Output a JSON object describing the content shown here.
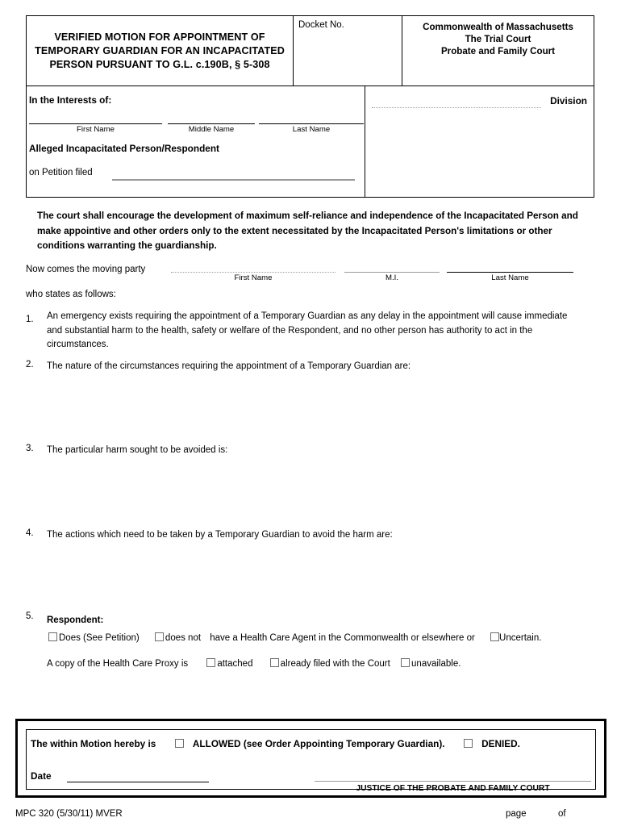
{
  "form": {
    "header": {
      "title": "VERIFIED MOTION FOR APPOINTMENT OF TEMPORARY GUARDIAN FOR AN INCAPACITATED PERSON  PURSUANT TO G.L. c.190B, § 5-308",
      "docket_label": "Docket No.",
      "docket_value": "",
      "court_line_1": "Commonwealth of Massachusetts",
      "court_line_2": "The Trial Court",
      "court_line_3": "Probate and Family Court"
    },
    "interests": {
      "label": "In the Interests of:",
      "first_name_value": "",
      "first_name_caption": "First Name",
      "middle_name_value": "",
      "middle_name_caption": "Middle Name",
      "last_name_value": "",
      "last_name_caption": "Last Name",
      "respondent_label": "Alleged Incapacitated Person/Respondent",
      "petition_label": "on Petition filed",
      "petition_value": "",
      "division_value": "",
      "division_label": "Division"
    },
    "instruction": "The court shall encourage the development of maximum self-reliance and independence of the Incapacitated Person and make appointive and other orders only to the extent necessitated by the Incapacitated Person's limitations or other conditions warranting the guardianship.",
    "moving_party": {
      "label": "Now comes the moving party",
      "first_name_value": "",
      "first_name_caption": "First Name",
      "mi_value": "",
      "mi_caption": "M.I.",
      "last_name_value": "",
      "last_name_caption": "Last Name"
    },
    "who_states": "who states as follows:",
    "items": [
      {
        "num": "1.",
        "text": "An emergency exists requiring the appointment of a Temporary Guardian as any delay in the appointment will cause immediate and substantial harm to the health, safety or welfare of the Respondent, and no other person has authority to act in the circumstances."
      },
      {
        "num": "2.",
        "text": "The nature of the circumstances requiring the appointment of a Temporary Guardian are:"
      },
      {
        "num": "3.",
        "text": "The particular harm sought to be avoided is:"
      },
      {
        "num": "4.",
        "text": "The actions which need to be taken by a Temporary Guardian to avoid the harm are:"
      }
    ],
    "respondent_item": {
      "num": "5.",
      "title": "Respondent:",
      "option_does": "Does (See Petition)",
      "option_does_not": "does not",
      "agent_text": "have a Health Care Agent in the Commonwealth or elsewhere or",
      "option_uncertain": "Uncertain.",
      "proxy_label": "A copy of the Health Care Proxy is",
      "option_attached": "attached",
      "option_already_filed": "already filed with the Court",
      "option_unavailable": "unavailable."
    },
    "order": {
      "lead_text": "The within Motion hereby is",
      "allowed_label": "ALLOWED (see Order Appointing Temporary Guardian).",
      "denied_label": "DENIED.",
      "date_label": "Date",
      "date_value": "",
      "signature_caption": "JUSTICE OF THE PROBATE AND FAMILY COURT"
    },
    "footer": {
      "form_code": "MPC 320 (5/30/11)   MVER",
      "page_label": "page",
      "of_label": "of"
    }
  }
}
